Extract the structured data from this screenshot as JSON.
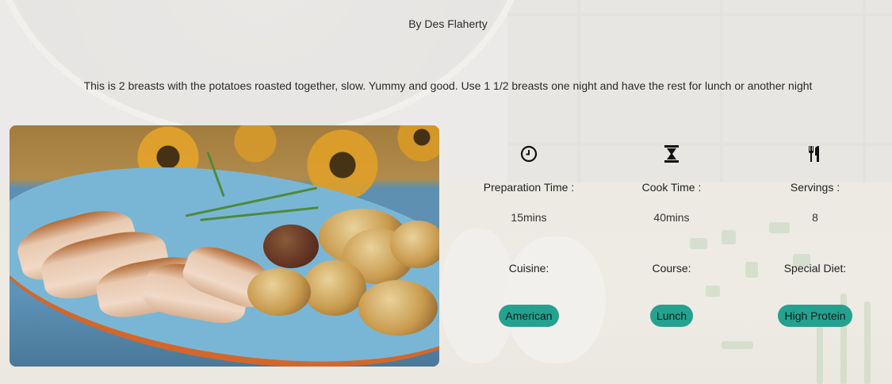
{
  "recipe": {
    "author": "By Des Flaherty",
    "description": "This is 2 breasts with the potatoes roasted together, slow. Yummy and good. Use 1 1/2 breasts one night and have the rest for lunch or another night"
  },
  "stats": {
    "prep": {
      "icon": "clock-icon",
      "label": "Preparation Time :",
      "value": "15mins"
    },
    "cook": {
      "icon": "hourglass-icon",
      "label": "Cook Time :",
      "value": "40mins"
    },
    "servings": {
      "icon": "cutlery-icon",
      "label": "Servings :",
      "value": "8"
    },
    "cuisine": {
      "label": "Cuisine:",
      "value": "American"
    },
    "course": {
      "label": "Course:",
      "value": "Lunch"
    },
    "diet": {
      "label": "Special Diet:",
      "value": "High Protein"
    }
  },
  "colors": {
    "badge": "#25a190"
  }
}
